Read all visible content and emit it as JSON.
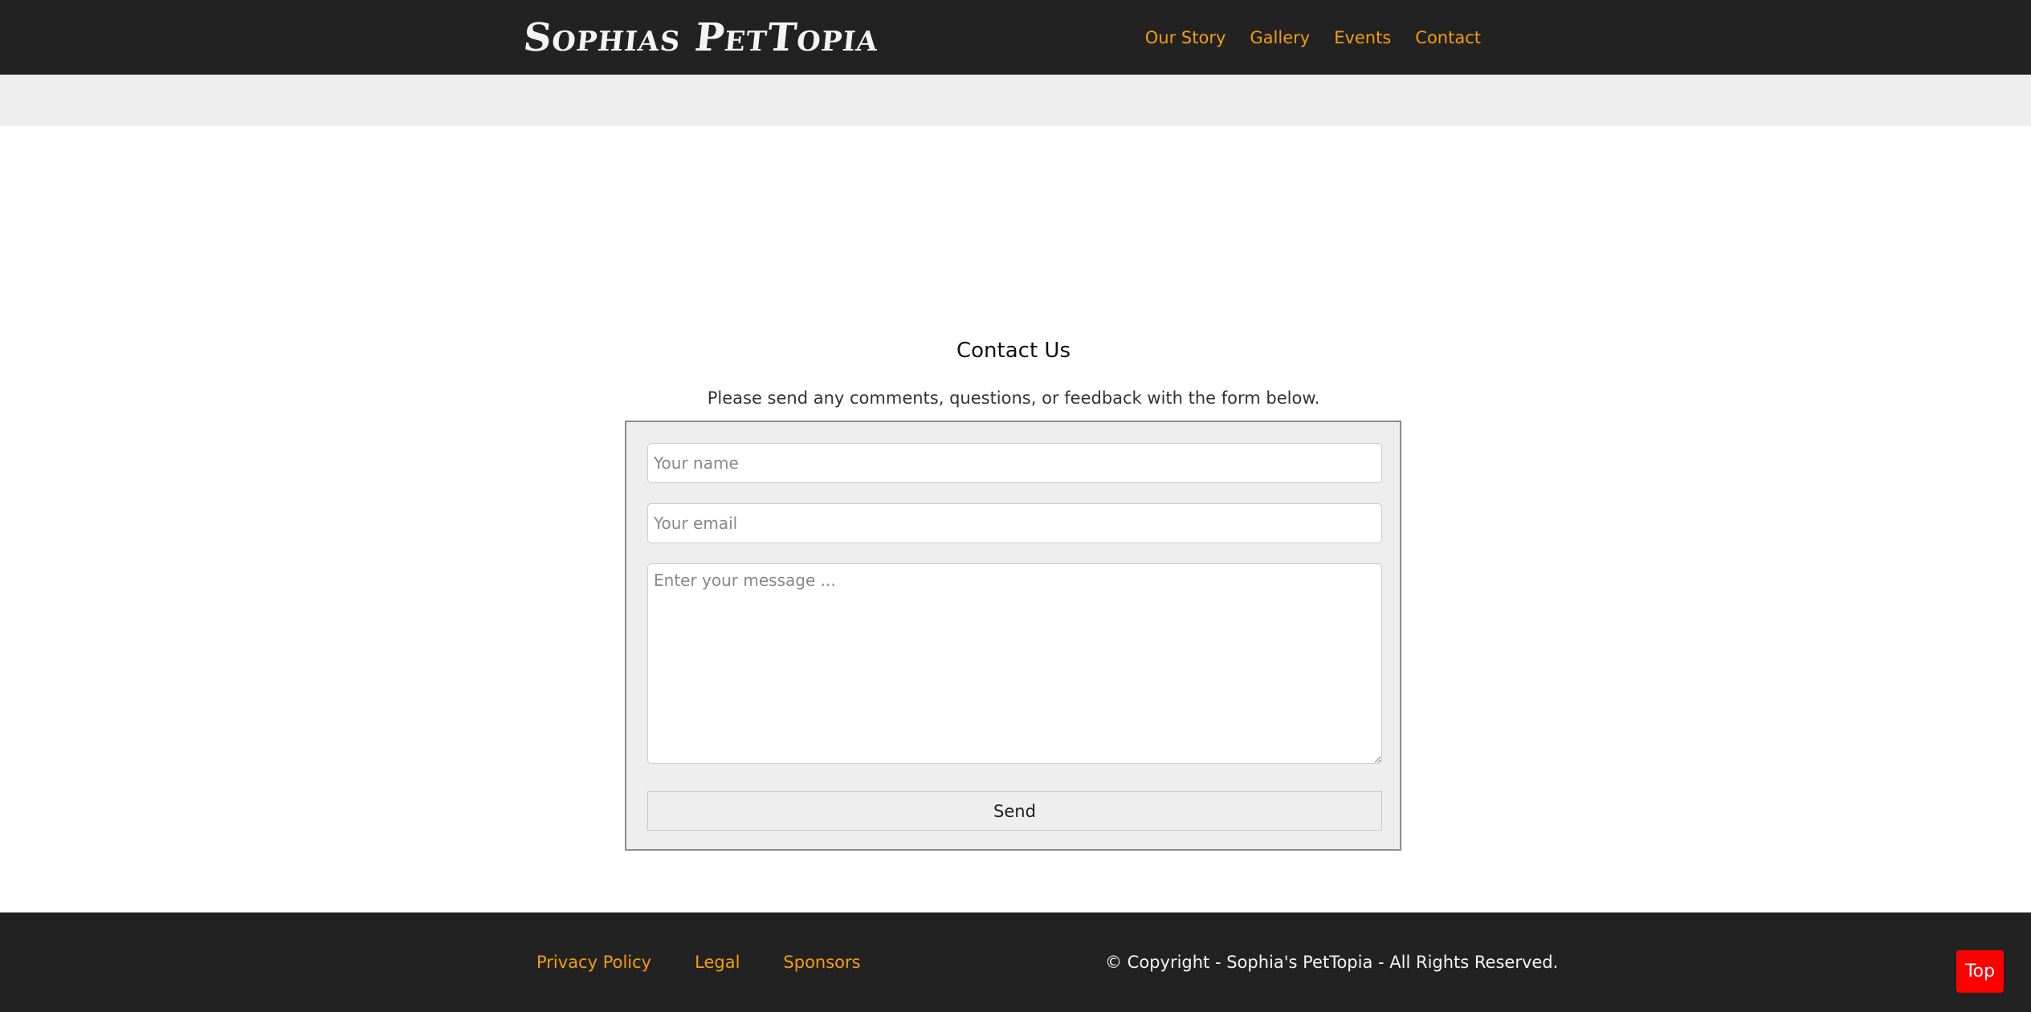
{
  "header": {
    "logo_text": "Sophias PetTopia",
    "nav": [
      {
        "label": "Our Story"
      },
      {
        "label": "Gallery"
      },
      {
        "label": "Events"
      },
      {
        "label": "Contact"
      }
    ]
  },
  "contact": {
    "title": "Contact Us",
    "intro": "Please send any comments, questions, or feedback with the form below.",
    "name_placeholder": "Your name",
    "email_placeholder": "Your email",
    "message_placeholder": "Enter your message ...",
    "send_label": "Send"
  },
  "footer": {
    "links": [
      {
        "label": "Privacy Policy"
      },
      {
        "label": "Legal"
      },
      {
        "label": "Sponsors"
      }
    ],
    "copyright": "© Copyright - Sophia's PetTopia - All Rights Reserved."
  },
  "top_button": {
    "label": "Top"
  },
  "colors": {
    "header_bg": "#222222",
    "accent": "#f39c12",
    "subbar_bg": "#eeeeee",
    "form_bg": "#eeeeee",
    "top_button_bg": "#ff0000"
  }
}
